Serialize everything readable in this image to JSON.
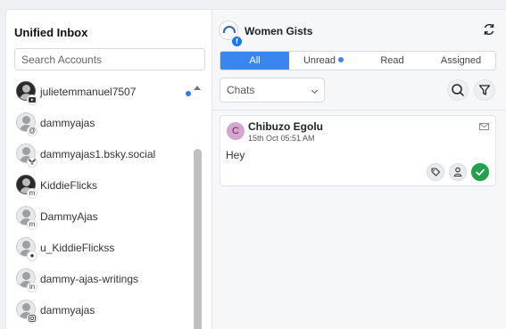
{
  "sidebar": {
    "title": "Unified Inbox",
    "search_placeholder": "Search Accounts",
    "accounts": [
      {
        "name": "julietemmanuel7507",
        "platform_icon": "youtube-icon",
        "unread": true
      },
      {
        "name": "dammyajas",
        "platform_icon": "threads-icon",
        "unread": false
      },
      {
        "name": "dammyajas1.bsky.social",
        "platform_icon": "bluesky-icon",
        "unread": false
      },
      {
        "name": "KiddieFlicks",
        "platform_icon": "mastodon-icon",
        "unread": false
      },
      {
        "name": "DammyAjas",
        "platform_icon": "mastodon-icon",
        "unread": false
      },
      {
        "name": "u_KiddieFlickss",
        "platform_icon": "reddit-icon",
        "unread": false
      },
      {
        "name": "dammy-ajas-writings",
        "platform_icon": "linkedin-icon",
        "unread": false
      },
      {
        "name": "dammyajas",
        "platform_icon": "instagram-icon",
        "unread": false
      }
    ]
  },
  "channel": {
    "title": "Women Gists",
    "platform_icon": "facebook-icon"
  },
  "tabs": [
    {
      "label": "All",
      "active": true
    },
    {
      "label": "Unread",
      "active": false,
      "has_dot": true
    },
    {
      "label": "Read",
      "active": false
    },
    {
      "label": "Assigned",
      "active": false
    }
  ],
  "filter": {
    "selected": "Chats"
  },
  "conversation": {
    "initial": "C",
    "sender": "Chibuzo Egolu",
    "time": "15th Oct 05:51 AM",
    "text": "Hey"
  },
  "colors": {
    "accent": "#3a86f0",
    "resolve": "#22a04b",
    "unread_dot": "#2f7de1",
    "avatar_bg": "#d4a5cf"
  }
}
